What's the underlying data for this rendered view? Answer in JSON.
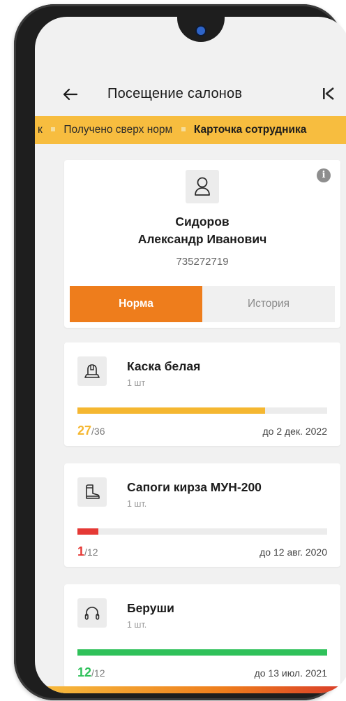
{
  "header": {
    "title": "Посещение салонов"
  },
  "breadcrumb": {
    "items": [
      "к",
      "Получено сверх норм",
      "Карточка сотрудника"
    ]
  },
  "profile": {
    "last_name": "Сидоров",
    "first_middle": "Александр Иванович",
    "employee_id": "735272719",
    "tabs": {
      "active": "Норма",
      "inactive": "История"
    }
  },
  "items": [
    {
      "name": "Каска белая",
      "qty": "1 шт",
      "count": "27",
      "total": "/36",
      "progress": 0.75,
      "due": "до 2 дек. 2022",
      "color": "#f5b731",
      "icon": "helmet-icon"
    },
    {
      "name": "Сапоги кирза МУН-200",
      "qty": "1 шт.",
      "count": "1",
      "total": "/12",
      "progress": 0.0833,
      "due": "до 12 авг. 2020",
      "color": "#e53935",
      "icon": "boot-icon"
    },
    {
      "name": "Беруши",
      "qty": "1 шт.",
      "count": "12",
      "total": "/12",
      "progress": 1.0,
      "due": "до 13 июл. 2021",
      "color": "#2fc15a",
      "icon": "earmuffs-icon"
    }
  ],
  "colors": {
    "accent": "#ee7d1c",
    "breadcrumb_bg": "#f7bd3f",
    "progress_track": "#ececec"
  }
}
